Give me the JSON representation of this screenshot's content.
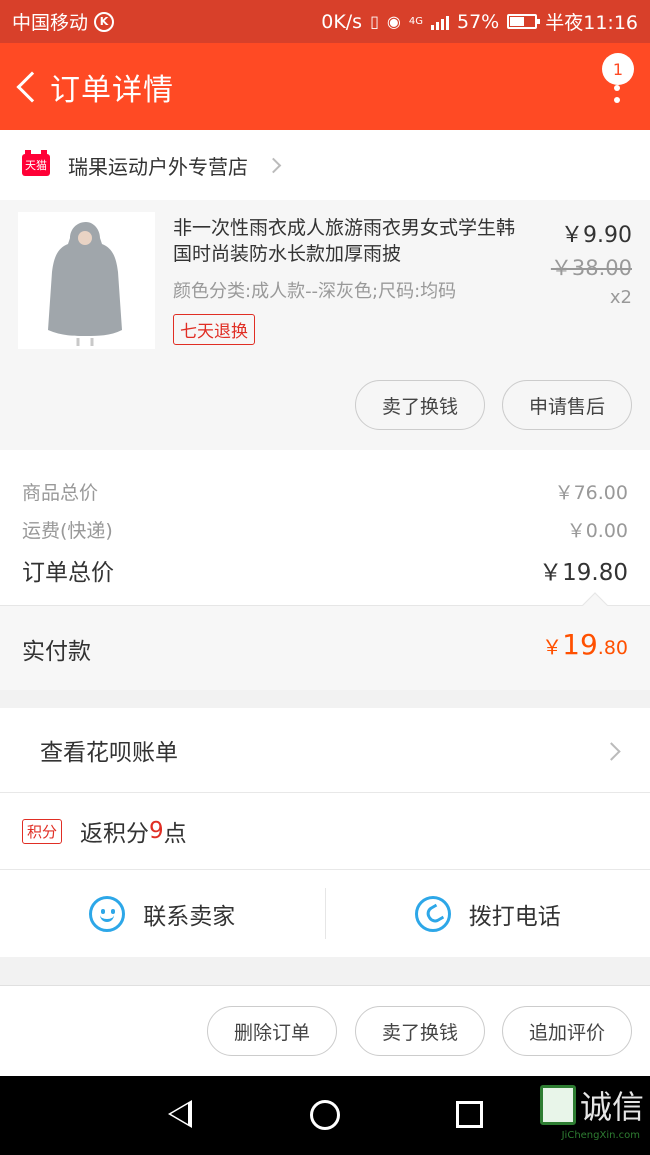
{
  "status_bar": {
    "carrier": "中国移动",
    "speed": "0K/s",
    "network": "4G",
    "battery": "57%",
    "time": "半夜11:16"
  },
  "header": {
    "title": "订单详情",
    "badge_count": "1"
  },
  "store": {
    "badge": "天猫",
    "name": "瑞果运动户外专营店"
  },
  "item": {
    "title": "非一次性雨衣成人旅游雨衣男女式学生韩国时尚装防水长款加厚雨披",
    "sku": "颜色分类:成人款--深灰色;尺码:均码",
    "tag": "七天退换",
    "price": "￥9.90",
    "original_price": "￥38.00",
    "quantity": "x2",
    "buttons": [
      "卖了换钱",
      "申请售后"
    ]
  },
  "summary": {
    "rows": [
      {
        "label": "商品总价",
        "value": "￥76.00"
      },
      {
        "label": "运费(快递)",
        "value": "￥0.00"
      },
      {
        "label": "订单总价",
        "value": "￥19.80"
      }
    ]
  },
  "paid": {
    "label": "实付款",
    "currency": "￥",
    "integer": "19",
    "decimal": ".80"
  },
  "huabei": {
    "label": "查看花呗账单"
  },
  "points": {
    "tag": "积分",
    "prefix": "返积分",
    "number": "9",
    "suffix": "点"
  },
  "contact": {
    "seller": "联系卖家",
    "phone": "拨打电话"
  },
  "actions": [
    "删除订单",
    "卖了换钱",
    "追加评价"
  ],
  "watermark": {
    "text": "诚信",
    "url": "JiChengXin.com"
  },
  "colors": {
    "header": "#ff4a24",
    "accent": "#ff5000",
    "tag": "#e02e24",
    "icon": "#2da7e8"
  }
}
